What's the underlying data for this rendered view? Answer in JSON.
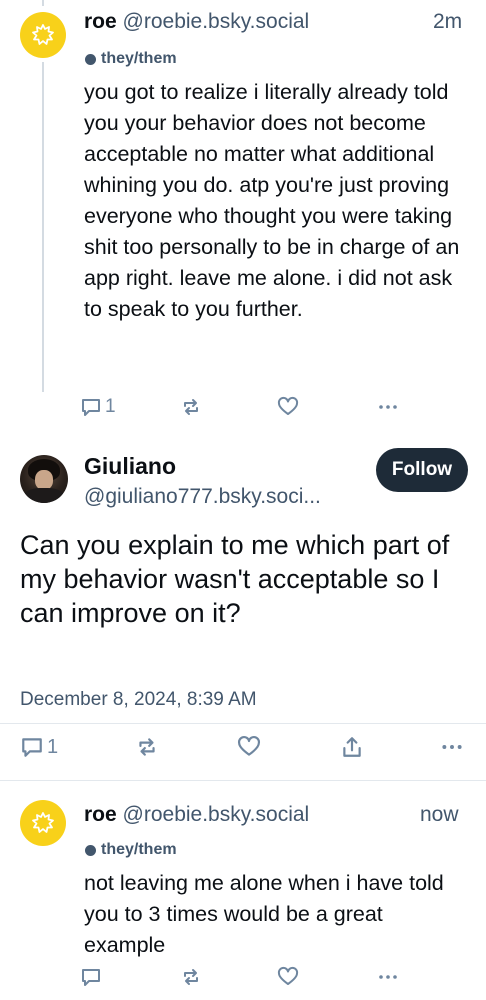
{
  "posts": [
    {
      "author_name": "roe",
      "author_handle": "@roebie.bsky.social",
      "time": "2m",
      "pronouns": "they/them",
      "text": "you got to realize i literally already told you your behavior does not become acceptable no matter what additional whining you do. atp you're just proving everyone who thought you were taking shit too personally to be in charge of an app right. leave me alone. i did not ask to speak to you further.",
      "reply_count": "1"
    },
    {
      "author_name": "Giuliano",
      "author_handle": "@giuliano777.bsky.soci...",
      "follow_label": "Follow",
      "text": "Can you explain to me which part of my behavior wasn't acceptable so I can improve on it?",
      "date": "December 8, 2024, 8:39 AM",
      "reply_count": "1"
    },
    {
      "author_name": "roe",
      "author_handle": "@roebie.bsky.social",
      "time": "now",
      "pronouns": "they/them",
      "text": "not leaving me alone when i have told you to 3 times would be a great example",
      "reply_count": ""
    }
  ],
  "icons": {
    "avatar_roe": "sun-badge-icon",
    "reply": "reply-icon",
    "repost": "repost-icon",
    "like": "heart-icon",
    "share": "share-icon",
    "more": "more-icon"
  },
  "colors": {
    "avatar_roe": "#f8d11a",
    "follow_button": "#1e2b38",
    "secondary_text": "#42566c",
    "action_icon": "#6f869f"
  }
}
